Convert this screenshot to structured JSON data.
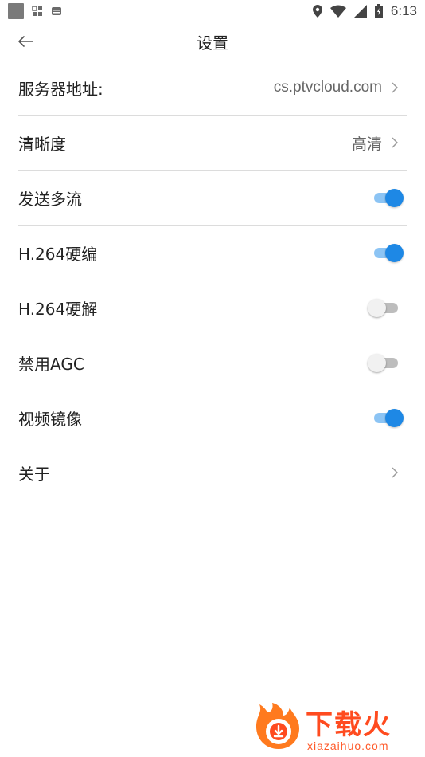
{
  "status_bar": {
    "time": "6:13",
    "left_icons": [
      "square-icon",
      "grid-icon",
      "mail-icon"
    ],
    "right_icons": [
      "location-icon",
      "wifi-icon",
      "signal-icon",
      "battery-icon"
    ]
  },
  "header": {
    "title": "设置",
    "back_icon": "arrow-left-icon"
  },
  "settings": [
    {
      "label": "服务器地址:",
      "value": "cs.ptvcloud.com",
      "type": "link"
    },
    {
      "label": "清晰度",
      "value": "高清",
      "type": "link"
    },
    {
      "label": "发送多流",
      "type": "toggle",
      "on": true
    },
    {
      "label": "H.264硬编",
      "type": "toggle",
      "on": true
    },
    {
      "label": "H.264硬解",
      "type": "toggle",
      "on": false
    },
    {
      "label": "禁用AGC",
      "type": "toggle",
      "on": false
    },
    {
      "label": "视频镜像",
      "type": "toggle",
      "on": true
    },
    {
      "label": "关于",
      "type": "link"
    }
  ],
  "watermark": {
    "text": "下载火",
    "url_text": "xiazaihuo.com"
  },
  "colors": {
    "accent": "#1e88e5",
    "accent_track": "#8cc4f4",
    "divider": "#dcdcdc",
    "watermark": "#ff4b1f"
  }
}
